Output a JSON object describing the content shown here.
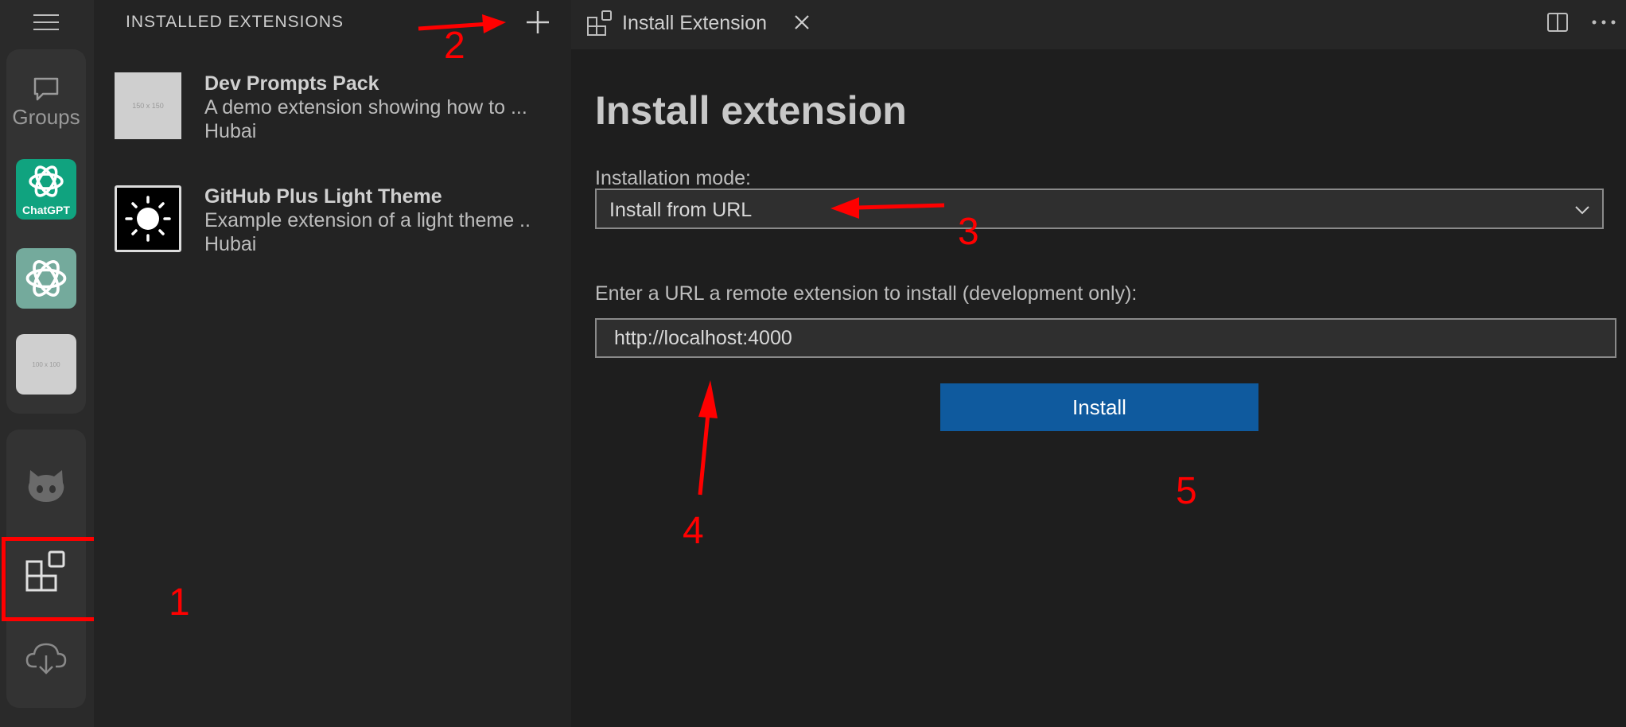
{
  "activity_bar": {
    "groups_label": "Groups",
    "chatgpt_label": "ChatGPT",
    "placeholder_label": "100 x 100"
  },
  "sidebar": {
    "title": "INSTALLED EXTENSIONS",
    "extensions": [
      {
        "name": "Dev Prompts Pack",
        "description": "A demo extension showing how to ...",
        "author": "Hubai",
        "thumb_label": "150 x 150"
      },
      {
        "name": "GitHub Plus Light Theme",
        "description": "Example extension of a light theme ..",
        "author": "Hubai"
      }
    ]
  },
  "editor": {
    "tab_label": "Install Extension",
    "heading": "Install extension",
    "mode_label": "Installation mode:",
    "mode_value": "Install from URL",
    "url_label": "Enter a URL a remote extension to install (development only):",
    "url_value": "http://localhost:4000",
    "install_label": "Install"
  },
  "annotations": {
    "step1": "1",
    "step2": "2",
    "step3": "3",
    "step4": "4",
    "step5": "5"
  },
  "colors": {
    "accent_button": "#0f5a9e",
    "annotation": "#ff0000",
    "chatgpt_green": "#10a37f"
  }
}
